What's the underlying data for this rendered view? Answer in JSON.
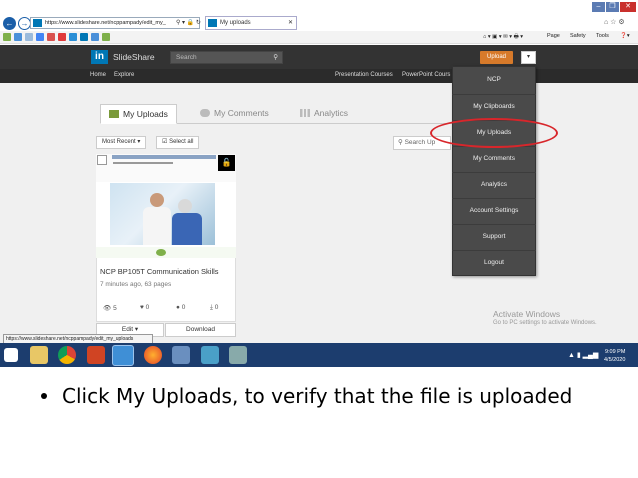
{
  "browser": {
    "address_url": "https://www.slideshare.net/ncppampady/edit_my_",
    "tab_title": "My uploads",
    "menu_page": "Page",
    "menu_safety": "Safety",
    "menu_tools": "Tools",
    "status_url": "https://www.slideshare.net/ncppampady/edit_my_uploads"
  },
  "header": {
    "logo_letters": "in",
    "brand": "SlideShare",
    "search_placeholder": "Search",
    "upload_label": "Upload"
  },
  "subnav": {
    "items": [
      "Home",
      "Explore"
    ],
    "right_items": [
      "Presentation Courses",
      "PowerPoint Cours"
    ]
  },
  "tabs": [
    {
      "label": "My Uploads",
      "active": true
    },
    {
      "label": "My Comments",
      "active": false
    },
    {
      "label": "Analytics",
      "active": false
    }
  ],
  "toolbar": {
    "sort_label": "Most Recent ▾",
    "select_all": "Select all",
    "search_placeholder": "Search Up"
  },
  "card": {
    "title": "NCP BP105T Communication Skills",
    "meta": "7 minutes ago, 63 pages",
    "views": "5",
    "likes": "0",
    "comments": "0",
    "downloads": "0",
    "edit_label": "Edit ▾",
    "download_label": "Download"
  },
  "dropdown": {
    "items": [
      "NCP",
      "My Clipboards",
      "My Uploads",
      "My Comments",
      "Analytics",
      "Account Settings",
      "Support",
      "Logout"
    ]
  },
  "watermark": {
    "line1": "Activate Windows",
    "line2": "Go to PC settings to activate Windows."
  },
  "taskbar": {
    "time": "9:09 PM",
    "date": "4/5/2020"
  },
  "slide": {
    "bullet": "Click My Uploads, to verify that the file is uploaded"
  },
  "colors": {
    "header_bg": "#333333",
    "upload_orange": "#d77a2a",
    "highlight_red": "#d8262b",
    "taskbar_blue": "#1c3d6e",
    "linkedin_blue": "#0077b5"
  }
}
